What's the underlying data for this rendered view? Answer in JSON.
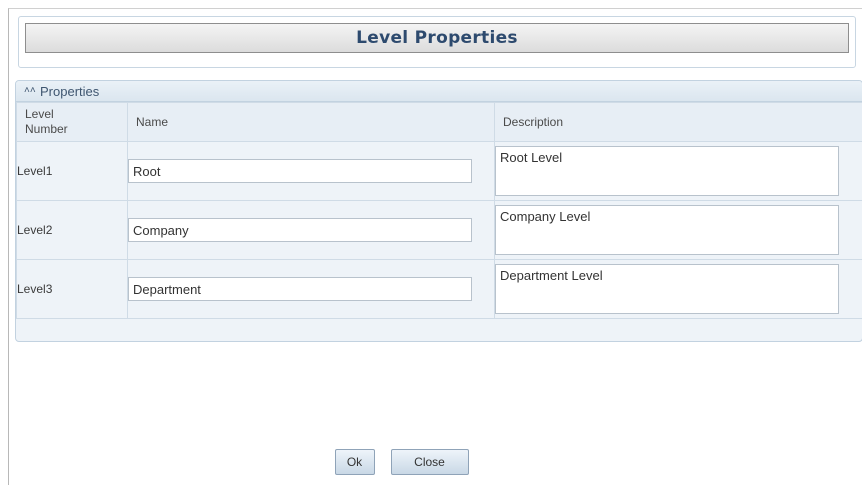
{
  "dialog": {
    "title": "Level Properties"
  },
  "panel": {
    "header": "Properties",
    "columns": {
      "level_number": "Level\nNumber",
      "name": "Name",
      "description": "Description"
    },
    "rows": [
      {
        "level": "Level1",
        "name": "Root",
        "description": "Root Level"
      },
      {
        "level": "Level2",
        "name": "Company",
        "description": "Company Level"
      },
      {
        "level": "Level3",
        "name": "Department",
        "description": "Department Level"
      }
    ]
  },
  "buttons": {
    "ok": "Ok",
    "close": "Close"
  },
  "icons": {
    "collapse": "collapse-up-icon"
  }
}
